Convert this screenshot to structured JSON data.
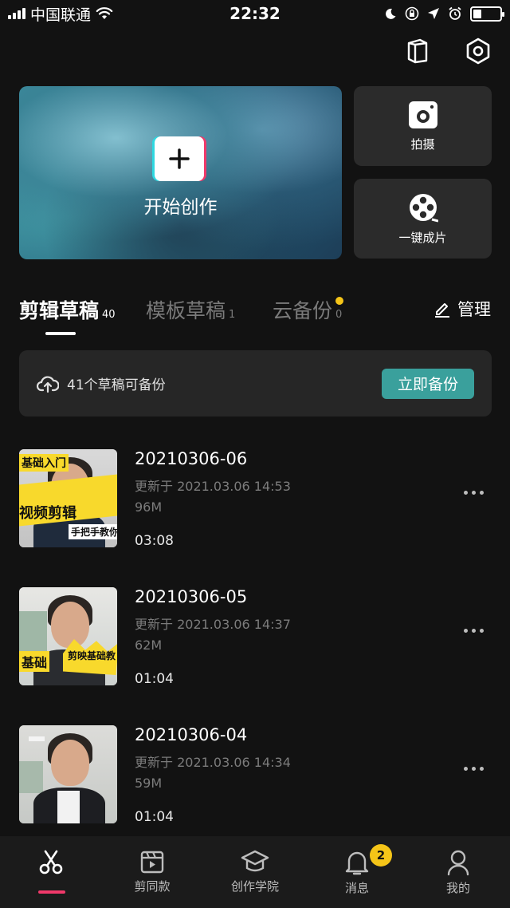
{
  "status_bar": {
    "carrier": "中国联通",
    "time": "22:32"
  },
  "header_icons": [
    "book-icon",
    "settings-hex-icon"
  ],
  "hero": {
    "label": "开始创作"
  },
  "side_cards": [
    {
      "label": "拍摄",
      "icon": "camera-icon"
    },
    {
      "label": "一键成片",
      "icon": "film-reel-icon"
    }
  ],
  "tabs": [
    {
      "label": "剪辑草稿",
      "count": "40",
      "active": true
    },
    {
      "label": "模板草稿",
      "count": "1",
      "active": false
    },
    {
      "label": "云备份",
      "count": "0",
      "active": false
    }
  ],
  "manage_label": "管理",
  "backup": {
    "text": "41个草稿可备份",
    "button": "立即备份"
  },
  "drafts": [
    {
      "title": "20210306-06",
      "updated": "更新于 2021.03.06 14:53",
      "size": "96M",
      "duration": "03:08",
      "thumb_captions": [
        "基础入门",
        "视频剪辑",
        "手把手教你"
      ]
    },
    {
      "title": "20210306-05",
      "updated": "更新于 2021.03.06 14:37",
      "size": "62M",
      "duration": "01:04",
      "thumb_captions": [
        "基础",
        "剪映基础教"
      ]
    },
    {
      "title": "20210306-04",
      "updated": "更新于 2021.03.06 14:34",
      "size": "59M",
      "duration": "01:04",
      "thumb_captions": []
    }
  ],
  "bottom_nav": [
    {
      "label": "",
      "icon": "scissors-icon",
      "active": true
    },
    {
      "label": "剪同款",
      "icon": "clapper-icon",
      "active": false
    },
    {
      "label": "创作学院",
      "icon": "graduation-cap-icon",
      "active": false
    },
    {
      "label": "消息",
      "icon": "bell-icon",
      "active": false,
      "badge": "2"
    },
    {
      "label": "我的",
      "icon": "person-icon",
      "active": false
    }
  ],
  "colors": {
    "accent_teal": "#3aa09c",
    "accent_pink": "#f0396a",
    "badge_yellow": "#f5c518",
    "background": "#121212"
  }
}
